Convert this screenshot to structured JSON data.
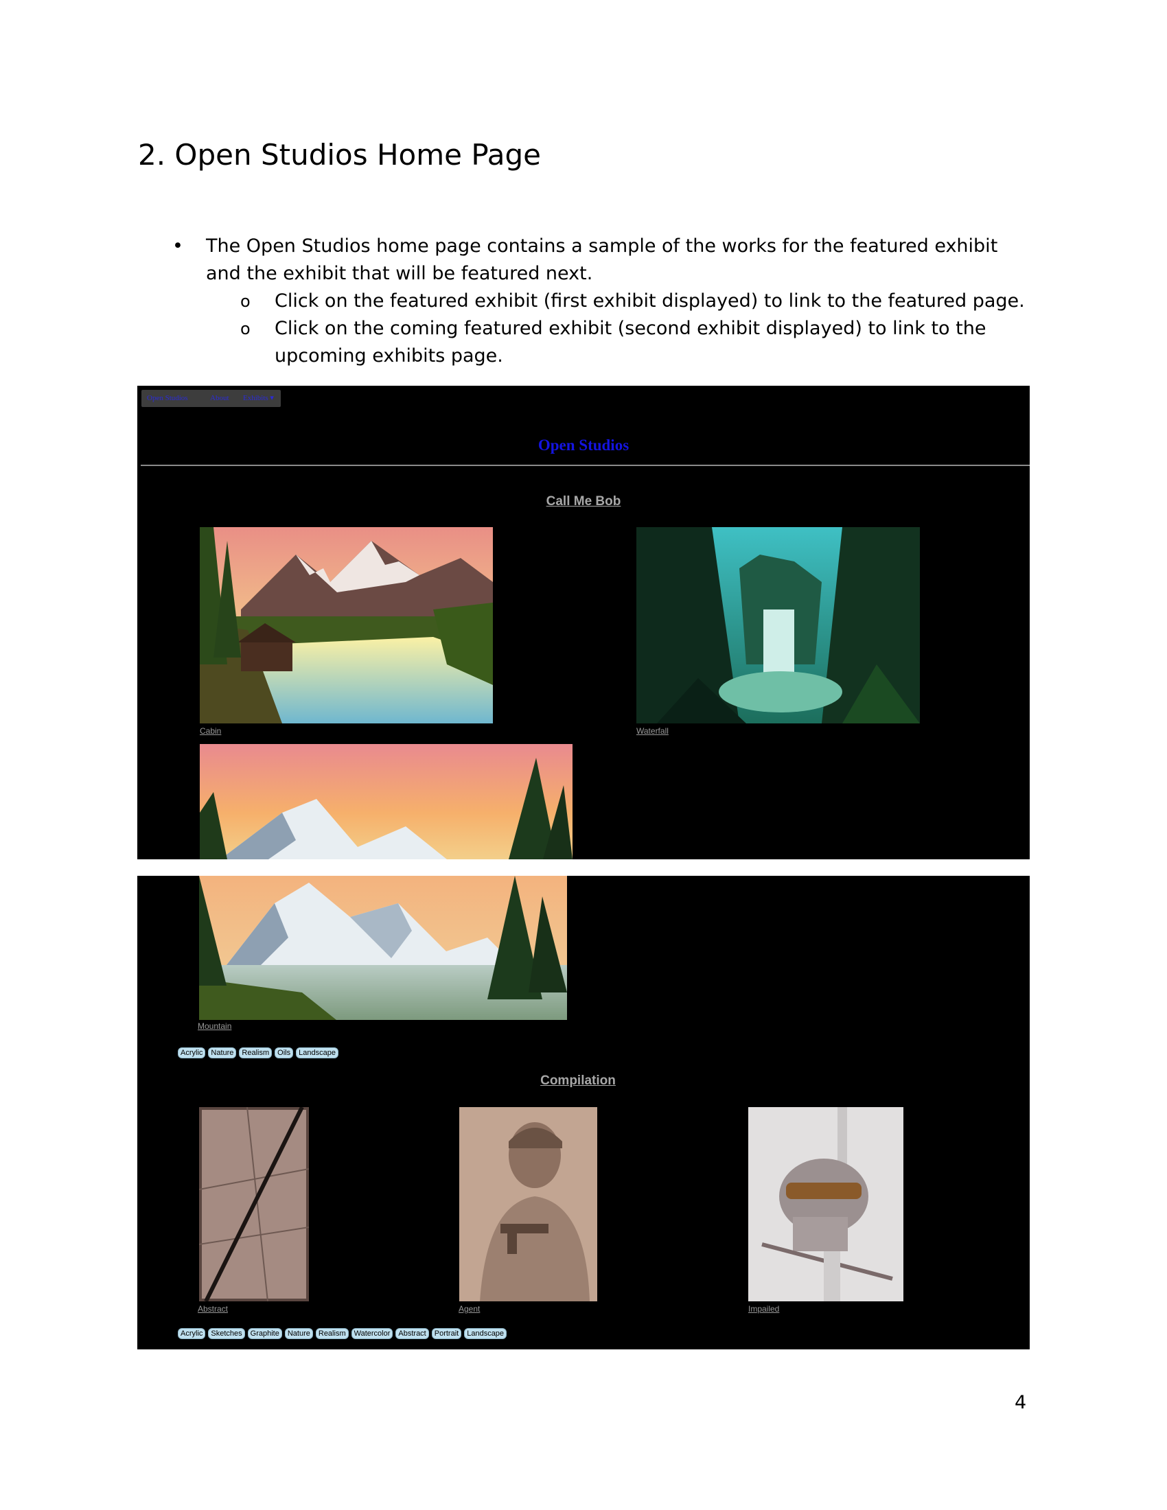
{
  "document": {
    "heading": "2. Open Studios Home Page",
    "bullet_symbol": "•",
    "sub_bullet_symbol": "o",
    "bullet_main": "The Open Studios home page contains a sample of the works for the featured exhibit and the exhibit that will be featured next.",
    "sub_bullets": [
      "Click on the featured exhibit (first exhibit displayed) to link to the featured page.",
      "Click on the coming featured exhibit (second exhibit displayed) to link to the upcoming exhibits page."
    ],
    "page_number": "4"
  },
  "site": {
    "nav": {
      "home": "Open Studios",
      "about": "About",
      "exhibits": "Exhibits ▾"
    },
    "title": "Open Studios"
  },
  "featured_exhibit": {
    "title": "Call Me Bob",
    "works": [
      {
        "caption": "Cabin",
        "icon": "landscape-painting"
      },
      {
        "caption": "Waterfall",
        "icon": "waterfall-painting"
      },
      {
        "caption": "Mountain",
        "icon": "mountain-painting"
      }
    ],
    "tags": [
      "Acrylic",
      "Nature",
      "Realism",
      "Oils",
      "Landscape"
    ]
  },
  "coming_exhibit": {
    "title": "Compilation",
    "works": [
      {
        "caption": "Abstract",
        "icon": "abstract-photo"
      },
      {
        "caption": "Agent",
        "icon": "sketch-portrait"
      },
      {
        "caption": "Impailed",
        "icon": "skull-sketch"
      }
    ],
    "tags": [
      "Acrylic",
      "Sketches",
      "Graphite",
      "Nature",
      "Realism",
      "Watercolor",
      "Abstract",
      "Portrait",
      "Landscape"
    ]
  },
  "colors": {
    "nav_link": "#2b2bd6",
    "site_title": "#1414e0",
    "tag_bg": "#bfe0ef",
    "page_bg": "#000000"
  }
}
